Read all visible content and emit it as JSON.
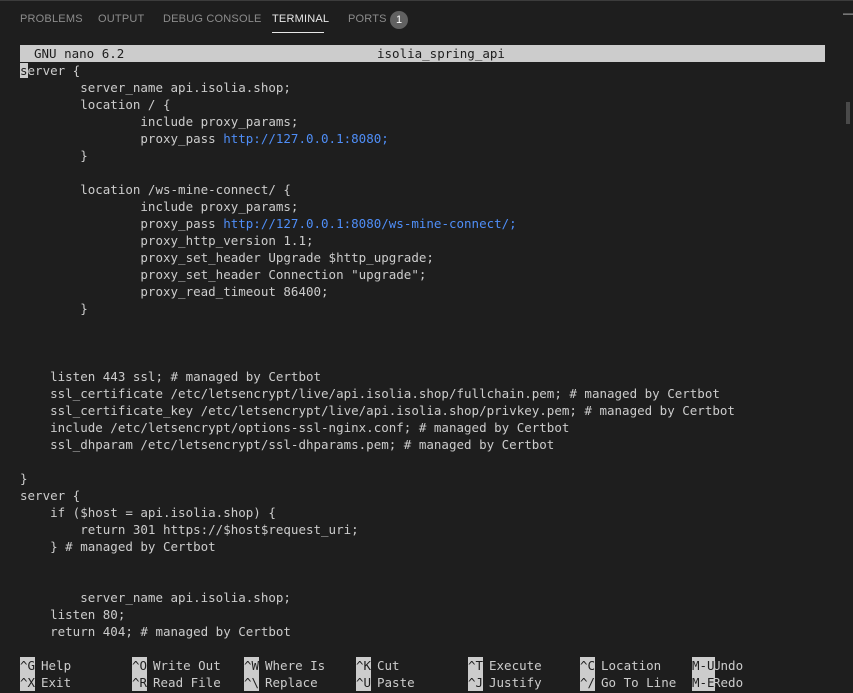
{
  "panel": {
    "tabs": [
      {
        "label": "PROBLEMS"
      },
      {
        "label": "OUTPUT"
      },
      {
        "label": "DEBUG CONSOLE"
      },
      {
        "label": "TERMINAL"
      },
      {
        "label": "PORTS"
      }
    ],
    "active_tab": "TERMINAL",
    "ports_badge": "1",
    "menu_icon": "minus-icon"
  },
  "nano": {
    "version": "GNU nano 6.2",
    "filename": "isolia_spring_api",
    "lines": [
      [
        {
          "t": "s",
          "cursor": true
        },
        {
          "t": "erver {"
        }
      ],
      [
        {
          "t": "        server_name api.isolia.shop;"
        }
      ],
      [
        {
          "t": "        location / {"
        }
      ],
      [
        {
          "t": "                include proxy_params;"
        }
      ],
      [
        {
          "t": "                proxy_pass "
        },
        {
          "t": "http://127.0.0.1:8080;",
          "url": true
        }
      ],
      [
        {
          "t": "        }"
        }
      ],
      [
        {
          "t": ""
        }
      ],
      [
        {
          "t": "        location /ws-mine-connect/ {"
        }
      ],
      [
        {
          "t": "                include proxy_params;"
        }
      ],
      [
        {
          "t": "                proxy_pass "
        },
        {
          "t": "http://127.0.0.1:8080/ws-mine-connect/;",
          "url": true
        }
      ],
      [
        {
          "t": "                proxy_http_version 1.1;"
        }
      ],
      [
        {
          "t": "                proxy_set_header Upgrade $http_upgrade;"
        }
      ],
      [
        {
          "t": "                proxy_set_header Connection \"upgrade\";"
        }
      ],
      [
        {
          "t": "                proxy_read_timeout 86400;"
        }
      ],
      [
        {
          "t": "        }"
        }
      ],
      [
        {
          "t": ""
        }
      ],
      [
        {
          "t": ""
        }
      ],
      [
        {
          "t": ""
        }
      ],
      [
        {
          "t": "    listen 443 ssl; # managed by Certbot"
        }
      ],
      [
        {
          "t": "    ssl_certificate /etc/letsencrypt/live/api.isolia.shop/fullchain.pem; # managed by Certbot"
        }
      ],
      [
        {
          "t": "    ssl_certificate_key /etc/letsencrypt/live/api.isolia.shop/privkey.pem; # managed by Certbot"
        }
      ],
      [
        {
          "t": "    include /etc/letsencrypt/options-ssl-nginx.conf; # managed by Certbot"
        }
      ],
      [
        {
          "t": "    ssl_dhparam /etc/letsencrypt/ssl-dhparams.pem; # managed by Certbot"
        }
      ],
      [
        {
          "t": ""
        }
      ],
      [
        {
          "t": "}"
        }
      ],
      [
        {
          "t": "server {"
        }
      ],
      [
        {
          "t": "    if ($host = api.isolia.shop) {"
        }
      ],
      [
        {
          "t": "        return 301 https://$host$request_uri;"
        }
      ],
      [
        {
          "t": "    } # managed by Certbot"
        }
      ],
      [
        {
          "t": ""
        }
      ],
      [
        {
          "t": ""
        }
      ],
      [
        {
          "t": "        server_name api.isolia.shop;"
        }
      ],
      [
        {
          "t": "    listen 80;"
        }
      ],
      [
        {
          "t": "    return 404; # managed by Certbot"
        }
      ]
    ],
    "shortcuts": [
      [
        {
          "key": "^G",
          "label": "Help"
        },
        {
          "key": "^X",
          "label": "Exit"
        }
      ],
      [
        {
          "key": "^O",
          "label": "Write Out"
        },
        {
          "key": "^R",
          "label": "Read File"
        }
      ],
      [
        {
          "key": "^W",
          "label": "Where Is"
        },
        {
          "key": "^\\",
          "label": "Replace"
        }
      ],
      [
        {
          "key": "^K",
          "label": "Cut"
        },
        {
          "key": "^U",
          "label": "Paste"
        }
      ],
      [
        {
          "key": "^T",
          "label": "Execute"
        },
        {
          "key": "^J",
          "label": "Justify"
        }
      ],
      [
        {
          "key": "^C",
          "label": "Location"
        },
        {
          "key": "^/",
          "label": "Go To Line"
        }
      ],
      [
        {
          "key": "M-U",
          "label": "Undo"
        },
        {
          "key": "M-E",
          "label": "Redo"
        }
      ]
    ]
  }
}
